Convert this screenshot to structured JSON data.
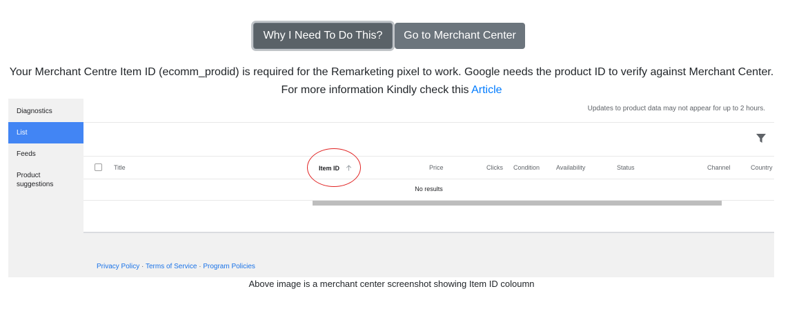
{
  "buttons": {
    "why": "Why I Need To Do This?",
    "merchant": "Go to Merchant Center"
  },
  "info": {
    "line1": "Your Merchant Centre Item ID (ecomm_prodid) is required for the Remarketing pixel to work. Google needs the product ID to verify against Merchant Center.",
    "line2": "For more information Kindly check this",
    "link": "Article"
  },
  "screenshot": {
    "sidebar": {
      "items": [
        {
          "label": "Diagnostics"
        },
        {
          "label": "List",
          "active": true
        },
        {
          "label": "Feeds"
        },
        {
          "label": "Product suggestions"
        }
      ]
    },
    "notice": "Updates to product data may not appear for up to 2 hours.",
    "filter_icon": "filter-icon",
    "columns": {
      "title": "Title",
      "item_id": "Item ID",
      "price": "Price",
      "clicks": "Clicks",
      "condition": "Condition",
      "availability": "Availability",
      "status": "Status",
      "channel": "Channel",
      "country": "Country"
    },
    "sort_icon": "arrow-up-icon",
    "empty": "No results",
    "footer": {
      "privacy": "Privacy Policy",
      "terms": "Terms of Service",
      "program": "Program Policies",
      "separator": " · "
    },
    "highlight_color": "#e02020",
    "active_color": "#4285f4"
  },
  "caption": "Above image is a merchant center screenshot showing Item ID coloumn"
}
